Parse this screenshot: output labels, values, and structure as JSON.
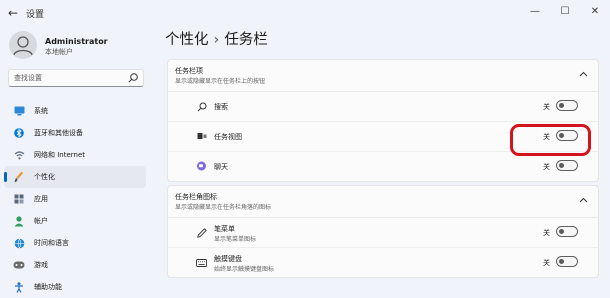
{
  "window": {
    "title": "设置",
    "back_icon": "back-arrow-icon",
    "controls": [
      "minimize-icon",
      "maximize-icon",
      "close-icon"
    ]
  },
  "user": {
    "name": "Administrator",
    "account_type": "本地帐户"
  },
  "search": {
    "placeholder": "查找设置",
    "icon": "search-icon"
  },
  "nav": {
    "items": [
      {
        "label": "系统",
        "icon": "monitor-icon",
        "color": "#0078d4"
      },
      {
        "label": "蓝牙和其他设备",
        "icon": "bluetooth-icon",
        "color": "#0078d4"
      },
      {
        "label": "网络和 Internet",
        "icon": "network-icon",
        "color": "#5a6a7a"
      },
      {
        "label": "个性化",
        "icon": "brush-icon",
        "color": "#e8912d",
        "selected": true
      },
      {
        "label": "应用",
        "icon": "apps-icon",
        "color": "#5a6a7a"
      },
      {
        "label": "帐户",
        "icon": "account-icon",
        "color": "#2aa05a"
      },
      {
        "label": "时间和语言",
        "icon": "globe-clock-icon",
        "color": "#0078d4"
      },
      {
        "label": "游戏",
        "icon": "gamepad-icon",
        "color": "#6b6b6b"
      },
      {
        "label": "辅助功能",
        "icon": "accessibility-icon",
        "color": "#1f6fc5"
      }
    ]
  },
  "breadcrumb": {
    "parent": "个性化",
    "separator": "›",
    "current": "任务栏"
  },
  "taskbar_items": {
    "title": "任务栏项",
    "description": "显示或隐藏显示在任务栏上的按钮",
    "rows": [
      {
        "label": "搜索",
        "icon": "search-icon",
        "state": "关",
        "on": false
      },
      {
        "label": "任务视图",
        "icon": "task-view-icon",
        "state": "关",
        "on": false
      },
      {
        "label": "聊天",
        "icon": "chat-icon",
        "state": "关",
        "on": false
      }
    ]
  },
  "corner_icons": {
    "title": "任务栏角图标",
    "description": "显示或隐藏显示在任务栏角落的图标",
    "rows": [
      {
        "label": "笔菜单",
        "desc": "显示笔菜单图标",
        "icon": "pen-icon",
        "state": "关",
        "on": false
      },
      {
        "label": "触摸键盘",
        "desc": "始终显示触摸键盘图标",
        "icon": "keyboard-icon",
        "state": "关",
        "on": false
      }
    ]
  },
  "accent_color": "#0067c0",
  "highlight_color": "#d3141c"
}
